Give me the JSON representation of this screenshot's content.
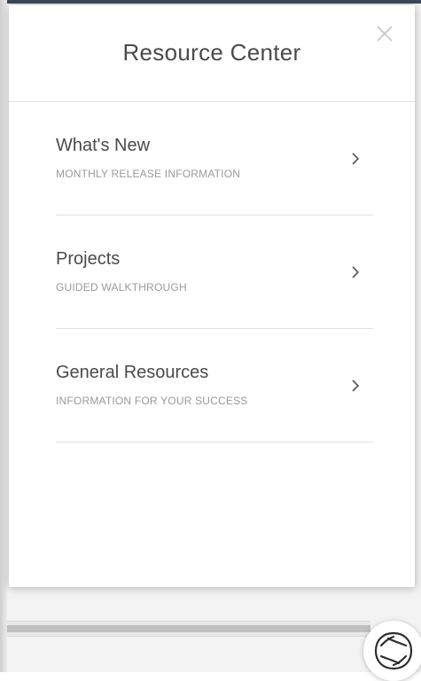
{
  "panel": {
    "title": "Resource Center",
    "close_icon": "close-icon"
  },
  "menu": {
    "items": [
      {
        "title": "What's New",
        "subtitle": "MONTHLY RELEASE INFORMATION",
        "icon": "chevron-right-icon"
      },
      {
        "title": "Projects",
        "subtitle": "GUIDED WALKTHROUGH",
        "icon": "chevron-right-icon"
      },
      {
        "title": "General Resources",
        "subtitle": "INFORMATION FOR YOUR SUCCESS",
        "icon": "chevron-right-icon"
      }
    ]
  },
  "launcher": {
    "icon": "resource-center-launcher-icon"
  },
  "colors": {
    "title_text": "#4a4a4a",
    "subtitle_text": "#9a9a9a",
    "divider": "#e1e1e1"
  }
}
